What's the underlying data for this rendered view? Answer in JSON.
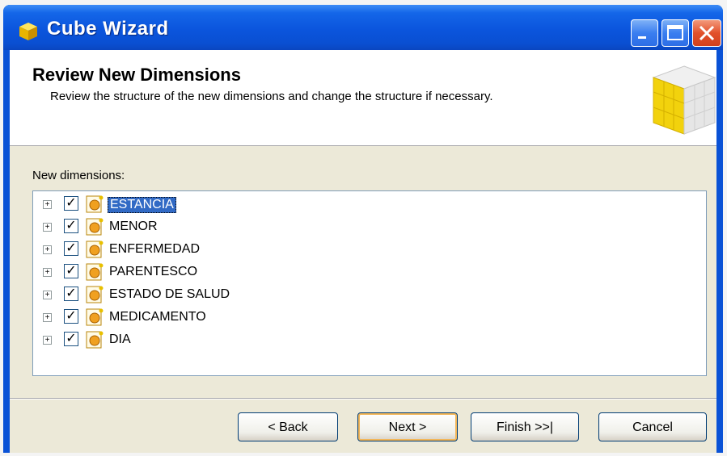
{
  "window": {
    "title": "Cube Wizard",
    "controls": {
      "minimize": "minimize-icon",
      "maximize": "maximize-icon",
      "close": "close-icon"
    }
  },
  "header": {
    "title": "Review New Dimensions",
    "description": "Review the structure of the new dimensions and change the structure if necessary."
  },
  "dimensions": {
    "label": "New dimensions:",
    "items": [
      {
        "label": "ESTANCIA",
        "checked": true,
        "selected": true
      },
      {
        "label": "MENOR",
        "checked": true,
        "selected": false
      },
      {
        "label": "ENFERMEDAD",
        "checked": true,
        "selected": false
      },
      {
        "label": "PARENTESCO",
        "checked": true,
        "selected": false
      },
      {
        "label": "ESTADO DE SALUD",
        "checked": true,
        "selected": false
      },
      {
        "label": "MEDICAMENTO",
        "checked": true,
        "selected": false
      },
      {
        "label": "DIA",
        "checked": true,
        "selected": false
      }
    ]
  },
  "buttons": {
    "back": "< Back",
    "next": "Next >",
    "finish": "Finish >>|",
    "cancel": "Cancel"
  },
  "colors": {
    "titlebar": "#0a52d6",
    "selection": "#316ac5",
    "dialog_bg": "#ece9d8",
    "cube_yellow": "#f2d20d"
  }
}
